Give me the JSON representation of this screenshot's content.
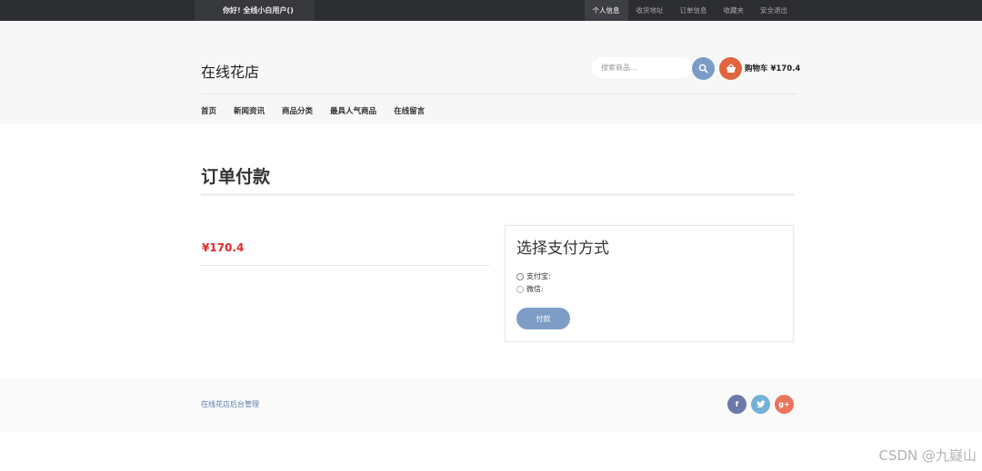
{
  "topbar": {
    "greeting": "你好!  全线小白用户()",
    "links": [
      "个人信息",
      "收货地址",
      "订单信息",
      "收藏夹",
      "安全退出"
    ]
  },
  "header": {
    "logo": "在线花店",
    "search": {
      "placeholder": "搜索商品..."
    },
    "cart_label": "购物车 ¥170.4",
    "nav": [
      "首页",
      "新闻资讯",
      "商品分类",
      "最具人气商品",
      "在线留言"
    ]
  },
  "main": {
    "page_title": "订单付款",
    "price": "¥170.4",
    "payment": {
      "title": "选择支付方式",
      "options": [
        "支付宝:",
        "微信:"
      ],
      "button": "付款"
    }
  },
  "footer": {
    "admin_link": "在线花店后台管理",
    "social": [
      "f",
      "t",
      "g+"
    ]
  },
  "watermark": "CSDN @九嶷山",
  "colors": {
    "topbar": "#2c2d31",
    "search_button": "#7a9dc7",
    "cart_button": "#e0643e",
    "price": "#e02a2a",
    "pay_button": "#7d9dc6"
  },
  "icons": {
    "search": "search-icon",
    "cart": "basket-icon",
    "facebook": "facebook-icon",
    "twitter": "twitter-icon",
    "googleplus": "google-plus-icon"
  }
}
